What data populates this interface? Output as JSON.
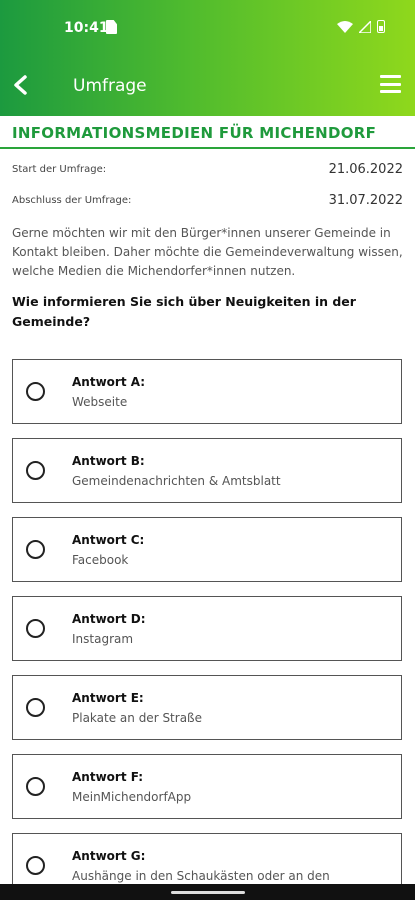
{
  "status_bar": {
    "time": "10:41"
  },
  "app_bar": {
    "title": "Umfrage"
  },
  "survey": {
    "title": "INFORMATIONSMEDIEN FÜR MICHENDORF",
    "start_label": "Start der Umfrage:",
    "start_value": "21.06.2022",
    "end_label": "Abschluss der Umfrage:",
    "end_value": "31.07.2022",
    "intro": "Gerne möchten wir mit den Bürger*innen unserer Gemeinde in Kontakt bleiben. Daher möchte die Gemeindeverwaltung wissen, welche Medien die Michendorfer*innen nutzen.",
    "question": "Wie informieren Sie sich über Neuigkeiten in der Gemeinde?",
    "answers": [
      {
        "label": "Antwort A:",
        "text": "Webseite"
      },
      {
        "label": "Antwort B:",
        "text": "Gemeindenachrichten & Amtsblatt"
      },
      {
        "label": "Antwort C:",
        "text": "Facebook"
      },
      {
        "label": "Antwort D:",
        "text": "Instagram"
      },
      {
        "label": "Antwort E:",
        "text": "Plakate an der Straße"
      },
      {
        "label": "Antwort F:",
        "text": "MeinMichendorfApp"
      },
      {
        "label": "Antwort G:",
        "text": "Aushänge in den Schaukästen oder an den"
      }
    ]
  }
}
